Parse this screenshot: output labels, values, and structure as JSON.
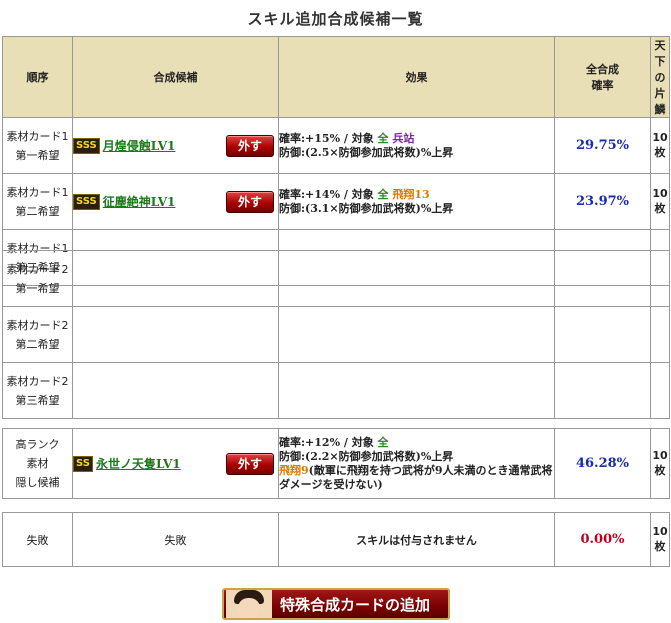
{
  "page": {
    "title": "スキル追加合成候補一覧"
  },
  "headers": {
    "order": "順序",
    "candidate": "合成候補",
    "effect": "効果",
    "rate_line1": "全合成",
    "rate_line2": "確率",
    "qty_line1": "天下の",
    "qty_line2": "片鱗"
  },
  "section1": [
    {
      "order_line1": "素材カード1",
      "order_line2": "第一希望",
      "rank": "SSS",
      "skill": "月煌侵蝕LV1",
      "remove": "外す",
      "eff_line1_prefix": "確率:+15% / 対象 ",
      "eff_target": "全",
      "eff_unit": "兵站",
      "eff_line2": "防御:(2.5×防御参加武将数)%上昇",
      "rate": "29.75%",
      "qty": "10枚"
    },
    {
      "order_line1": "素材カード1",
      "order_line2": "第二希望",
      "rank": "SSS",
      "skill": "征塵絶神LV1",
      "remove": "外す",
      "eff_line1_prefix": "確率:+14% / 対象 ",
      "eff_target": "全",
      "eff_unit": "飛翔13",
      "eff_line2": "防御:(3.1×防御参加武将数)%上昇",
      "rate": "23.97%",
      "qty": "10枚"
    },
    {
      "order_line1": "素材カード1",
      "order_line2": "第三希望"
    }
  ],
  "section2": [
    {
      "order_line1": "素材カード2",
      "order_line2": "第一希望"
    },
    {
      "order_line1": "素材カード2",
      "order_line2": "第二希望"
    },
    {
      "order_line1": "素材カード2",
      "order_line2": "第三希望"
    }
  ],
  "hidden": {
    "order_line1": "高ランク",
    "order_line2": "素材",
    "order_line3": "隠し候補",
    "rank": "SS",
    "skill": "永世ノ天隻LV1",
    "remove": "外す",
    "eff_line1_prefix": "確率:+12% / 対象 ",
    "eff_target": "全",
    "eff_line2": "防御:(2.2×防御参加武将数)%上昇",
    "eff_line3_highlight": "飛翔9",
    "eff_line3_rest": "(敵軍に飛翔を持つ武将が9人未満のとき通常武将ダメージを受けない)",
    "rate": "46.28%",
    "qty": "10枚"
  },
  "fail": {
    "order": "失敗",
    "candidate": "失敗",
    "effect": "スキルは付与されません",
    "rate": "0.00%",
    "qty": "10枚"
  },
  "add_button": {
    "label": "特殊合成カードの追加"
  },
  "colors": {
    "header_bg": "#e9dfb6",
    "rate_blue": "#1a2ab0",
    "rate_red": "#c0001a",
    "button_red": "#a01818"
  }
}
